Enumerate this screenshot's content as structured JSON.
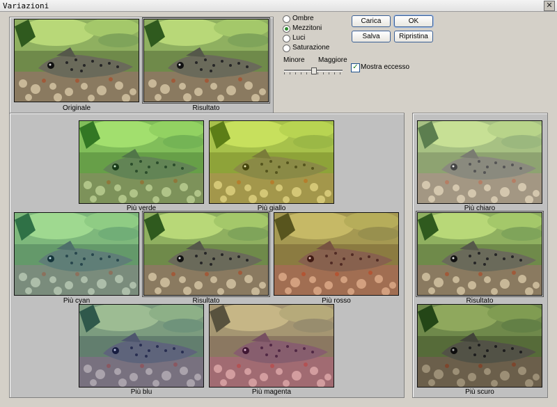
{
  "window": {
    "title": "Variazioni",
    "close_glyph": "✕"
  },
  "top": {
    "original_caption": "Originale",
    "result_caption": "Risultato"
  },
  "tone_options": [
    {
      "label": "Ombre",
      "mnemonic_label": "Ombre",
      "selected": false
    },
    {
      "label": "Mezzitoni",
      "selected": true
    },
    {
      "label": "Luci",
      "selected": false
    },
    {
      "label": "Saturazione",
      "selected": false
    }
  ],
  "buttons": {
    "load": "Carica",
    "ok": "OK",
    "save": "Salva",
    "reset": "Ripristina"
  },
  "slider": {
    "min_label": "Minore",
    "max_label": "Maggiore",
    "position": 0.5
  },
  "show_clipping": {
    "label": "Mostra eccesso",
    "checked": true,
    "check_glyph": "✓"
  },
  "color_grid": {
    "more_green": "Più verde",
    "more_yellow": "Più giallo",
    "more_cyan": "Più cyan",
    "current": "Risultato",
    "more_red": "Più rosso",
    "more_blue": "Più blu",
    "more_magenta": "Più magenta"
  },
  "brightness": {
    "lighter": "Più chiaro",
    "current": "Risultato",
    "darker": "Più scuro"
  }
}
